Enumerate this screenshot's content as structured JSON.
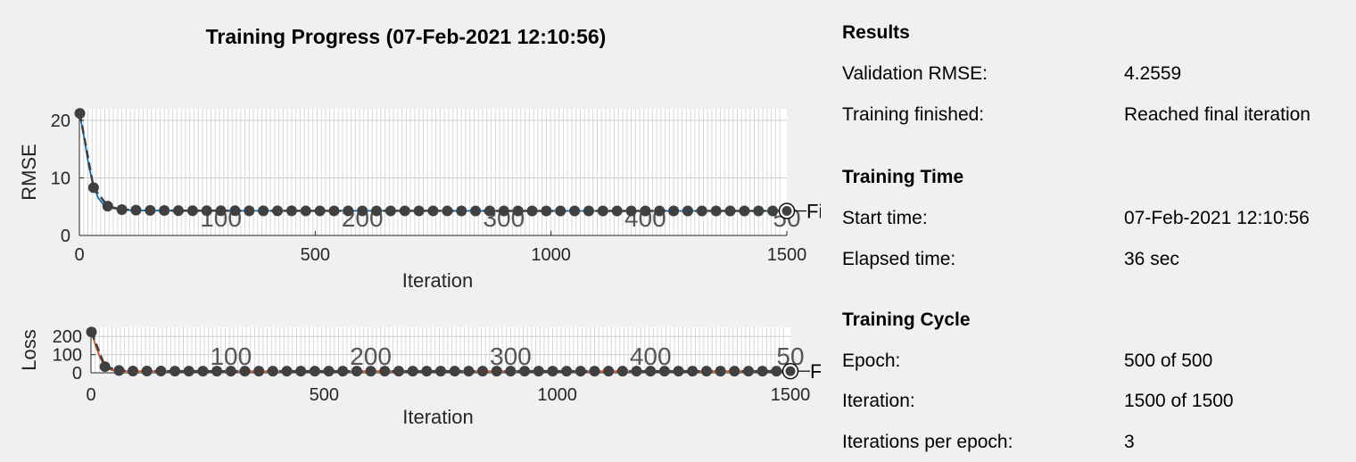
{
  "title": "Training Progress (07-Feb-2021 12:10:56)",
  "results": {
    "section_title": "Results",
    "rows": [
      {
        "label": "Validation RMSE:",
        "value": "4.2559"
      },
      {
        "label": "Training finished:",
        "value": "Reached final iteration"
      }
    ]
  },
  "training_time": {
    "section_title": "Training Time",
    "rows": [
      {
        "label": "Start time:",
        "value": "07-Feb-2021 12:10:56"
      },
      {
        "label": "Elapsed time:",
        "value": "36 sec"
      }
    ]
  },
  "training_cycle": {
    "section_title": "Training Cycle",
    "rows": [
      {
        "label": "Epoch:",
        "value": "500 of 500"
      },
      {
        "label": "Iteration:",
        "value": "1500 of 1500"
      },
      {
        "label": "Iterations per epoch:",
        "value": "3"
      }
    ]
  },
  "chart_data": [
    {
      "type": "line",
      "ylabel": "RMSE",
      "xlabel": "Iteration",
      "xlim": [
        0,
        1500
      ],
      "ylim": [
        0,
        22
      ],
      "x_ticks": [
        0,
        500,
        1000,
        1500
      ],
      "y_ticks": [
        0,
        10,
        20
      ],
      "epoch_labels": [
        "100",
        "200",
        "300",
        "400",
        "50"
      ],
      "epoch_label_iterations": [
        300,
        600,
        900,
        1200,
        1500
      ],
      "final_label": "Fi",
      "grid": true,
      "series": [
        {
          "role": "training",
          "color": "#0072bd",
          "x": [
            1,
            10,
            20,
            30,
            40,
            50,
            60,
            80,
            100,
            150,
            200,
            300,
            500,
            750,
            1000,
            1250,
            1500
          ],
          "y": [
            21,
            17,
            12,
            8.5,
            6.5,
            5.5,
            4.9,
            4.6,
            4.4,
            4.3,
            4.3,
            4.28,
            4.27,
            4.27,
            4.26,
            4.26,
            4.26
          ]
        },
        {
          "role": "validation",
          "color": "#404040",
          "x": [
            1,
            30,
            60,
            90,
            120,
            150,
            180,
            210,
            240,
            270,
            300,
            330,
            360,
            390,
            420,
            450,
            480,
            510,
            540,
            570,
            600,
            630,
            660,
            690,
            720,
            750,
            780,
            810,
            840,
            870,
            900,
            930,
            960,
            990,
            1020,
            1050,
            1080,
            1110,
            1140,
            1170,
            1200,
            1230,
            1260,
            1290,
            1320,
            1350,
            1380,
            1410,
            1440,
            1470,
            1500
          ],
          "y": [
            21.2,
            8.3,
            5.1,
            4.5,
            4.4,
            4.35,
            4.33,
            4.31,
            4.3,
            4.3,
            4.29,
            4.29,
            4.28,
            4.28,
            4.28,
            4.28,
            4.27,
            4.27,
            4.27,
            4.27,
            4.27,
            4.27,
            4.27,
            4.27,
            4.27,
            4.27,
            4.27,
            4.26,
            4.26,
            4.26,
            4.26,
            4.26,
            4.26,
            4.26,
            4.26,
            4.26,
            4.26,
            4.26,
            4.26,
            4.26,
            4.26,
            4.26,
            4.26,
            4.26,
            4.26,
            4.26,
            4.26,
            4.26,
            4.26,
            4.26,
            4.2559
          ]
        }
      ],
      "final_marker": {
        "x": 1500,
        "y": 4.2559
      }
    },
    {
      "type": "line",
      "ylabel": "Loss",
      "xlabel": "Iteration",
      "xlim": [
        0,
        1500
      ],
      "ylim": [
        0,
        250
      ],
      "x_ticks": [
        0,
        500,
        1000,
        1500
      ],
      "y_ticks": [
        0,
        100,
        200
      ],
      "epoch_labels": [
        "100",
        "200",
        "300",
        "400",
        "50"
      ],
      "epoch_label_iterations": [
        300,
        600,
        900,
        1200,
        1500
      ],
      "final_label": "Fi",
      "grid": true,
      "series": [
        {
          "role": "training",
          "color": "#d95319",
          "x": [
            1,
            10,
            20,
            30,
            40,
            50,
            60,
            80,
            100,
            150,
            200,
            300,
            500,
            750,
            1000,
            1250,
            1500
          ],
          "y": [
            220,
            150,
            80,
            35,
            18,
            12,
            10,
            9.5,
            9.2,
            9.1,
            9.1,
            9.05,
            9.05,
            9.05,
            9.05,
            9.05,
            9.05
          ]
        },
        {
          "role": "validation",
          "color": "#404040",
          "x": [
            1,
            30,
            60,
            90,
            120,
            150,
            180,
            210,
            240,
            270,
            300,
            330,
            360,
            390,
            420,
            450,
            480,
            510,
            540,
            570,
            600,
            630,
            660,
            690,
            720,
            750,
            780,
            810,
            840,
            870,
            900,
            930,
            960,
            990,
            1020,
            1050,
            1080,
            1110,
            1140,
            1170,
            1200,
            1230,
            1260,
            1290,
            1320,
            1350,
            1380,
            1410,
            1440,
            1470,
            1500
          ],
          "y": [
            224,
            34,
            13,
            10,
            9.7,
            9.5,
            9.4,
            9.3,
            9.3,
            9.2,
            9.2,
            9.2,
            9.2,
            9.2,
            9.2,
            9.1,
            9.1,
            9.1,
            9.1,
            9.1,
            9.1,
            9.1,
            9.1,
            9.1,
            9.1,
            9.1,
            9.1,
            9.1,
            9.1,
            9.1,
            9.1,
            9.1,
            9.1,
            9.1,
            9.1,
            9.1,
            9.1,
            9.1,
            9.1,
            9.1,
            9.1,
            9.1,
            9.1,
            9.1,
            9.1,
            9.1,
            9.1,
            9.1,
            9.1,
            9.1,
            9.06
          ]
        }
      ],
      "final_marker": {
        "x": 1500,
        "y": 9.06
      }
    }
  ]
}
